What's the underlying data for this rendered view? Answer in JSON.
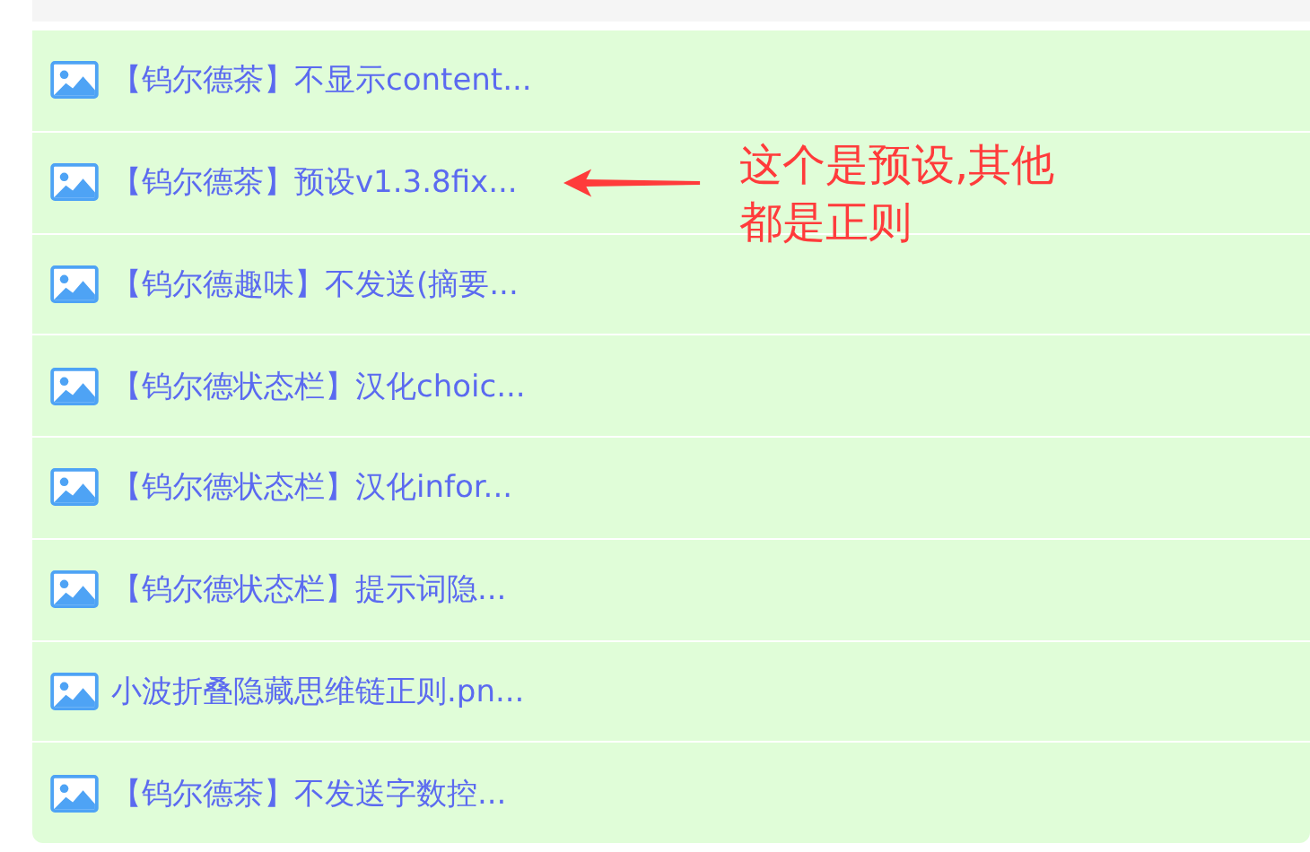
{
  "files": [
    {
      "name": "【钨尔德茶】不显示content..."
    },
    {
      "name": "【钨尔德茶】预设v1.3.8fix..."
    },
    {
      "name": "【钨尔德趣味】不发送(摘要..."
    },
    {
      "name": "【钨尔德状态栏】汉化choic..."
    },
    {
      "name": "【钨尔德状态栏】汉化infor..."
    },
    {
      "name": "【钨尔德状态栏】提示词隐..."
    },
    {
      "name": "小波折叠隐藏思维链正则.pn..."
    },
    {
      "name": "【钨尔德茶】不发送字数控..."
    }
  ],
  "annotation": {
    "lines": [
      "这个是预设,其他",
      "都是正则"
    ]
  }
}
